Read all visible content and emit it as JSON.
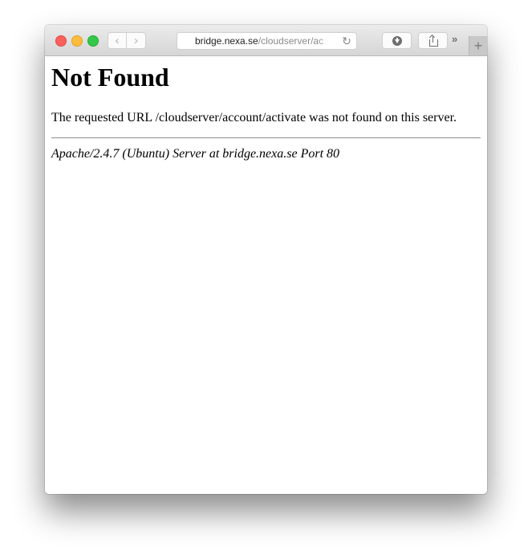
{
  "window": {
    "traffic_lights": {
      "close_color": "#fc605c",
      "minimize_color": "#fdbc40",
      "maximize_color": "#34c84a"
    },
    "toolbar": {
      "back_icon": "‹",
      "forward_icon": "›",
      "url_host": "bridge.nexa.se",
      "url_path": "/cloudserver/ac",
      "reload_icon": "↻",
      "overflow_icon": "»",
      "new_tab_icon": "+"
    }
  },
  "page": {
    "heading": "Not Found",
    "message": "The requested URL /cloudserver/account/activate was not found on this server.",
    "server_signature": "Apache/2.4.7 (Ubuntu) Server at bridge.nexa.se Port 80"
  }
}
